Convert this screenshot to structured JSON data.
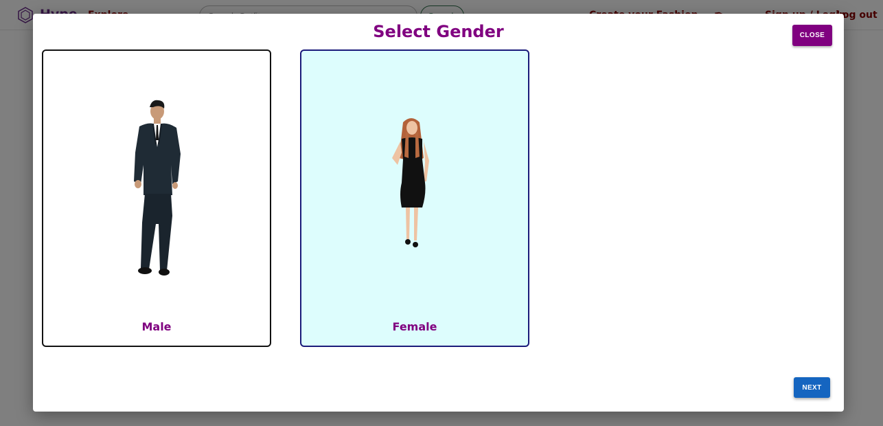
{
  "app": {
    "brand": "Hype",
    "nav_explore": "Explore",
    "search_placeholder": "Search Outfits",
    "search_button": "Search",
    "nav_customize": "Create your Fashion",
    "nav_signup": "Sign up / Login",
    "nav_logout": "Log out"
  },
  "modal": {
    "title": "Select Gender",
    "close_label": "CLOSE",
    "next_label": "NEXT",
    "options": [
      {
        "label": "Male",
        "selected": false
      },
      {
        "label": "Female",
        "selected": true
      }
    ]
  },
  "colors": {
    "accent": "#800080",
    "next_button": "#1565c0",
    "selected_card_bg": "#ddfdfd"
  }
}
